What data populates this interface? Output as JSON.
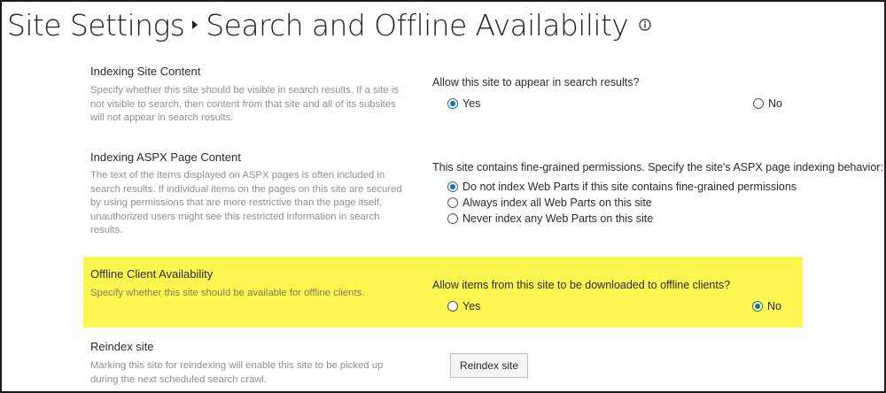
{
  "breadcrumb": {
    "parent": "Site Settings",
    "current": "Search and Offline Availability"
  },
  "sections": {
    "indexing_site": {
      "title": "Indexing Site Content",
      "description": "Specify whether this site should be visible in search results. If a site is not visible to search, then content from that site and all of its subsites will not appear in search results.",
      "question": "Allow this site to appear in search results?",
      "options": [
        {
          "label": "Yes",
          "selected": true
        },
        {
          "label": "No",
          "selected": false
        }
      ]
    },
    "indexing_aspx": {
      "title": "Indexing ASPX Page Content",
      "description": "The text of the items displayed on ASPX pages is often included in search results. If individual items on the pages on this site are secured by using permissions that are more restrictive than the page itself, unauthorized users might see this restricted information in search results.",
      "question": "This site contains fine-grained permissions. Specify the site's ASPX page indexing behavior:",
      "options": [
        {
          "label": "Do not index Web Parts if this site contains fine-grained permissions",
          "selected": true
        },
        {
          "label": "Always index all Web Parts on this site",
          "selected": false
        },
        {
          "label": "Never index any Web Parts on this site",
          "selected": false
        }
      ]
    },
    "offline": {
      "title": "Offline Client Availability",
      "description": "Specify whether this site should be available for offline clients.",
      "question": "Allow items from this site to be downloaded to offline clients?",
      "highlight_color": "#fdf650",
      "options": [
        {
          "label": "Yes",
          "selected": false
        },
        {
          "label": "No",
          "selected": true
        }
      ]
    },
    "reindex": {
      "title": "Reindex site",
      "description": "Marking this site for reindexing will enable this site to be picked up during the next scheduled search crawl.",
      "button_label": "Reindex site"
    }
  },
  "colors": {
    "radio_selected": "#1a6fc0",
    "radio_selected_highlight": "#1f7a44",
    "description_text": "#8f8f8f"
  },
  "icons": {
    "separator": "chevron-right-icon",
    "info": "info-icon"
  }
}
